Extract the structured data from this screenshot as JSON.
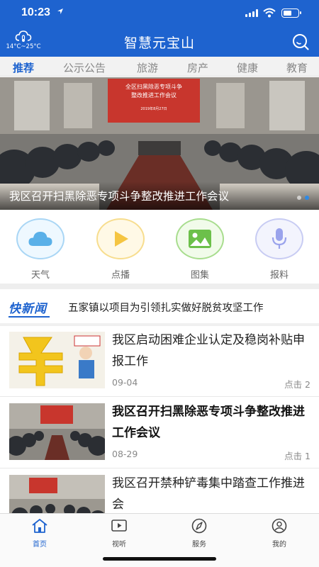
{
  "status": {
    "time": "10:23"
  },
  "header": {
    "weather_temp": "14°C~25°C",
    "title": "智慧元宝山"
  },
  "tabs": [
    "推荐",
    "公示公告",
    "旅游",
    "房产",
    "健康",
    "教育"
  ],
  "banner": {
    "caption": "我区召开扫黑除恶专项斗争整改推进工作会议",
    "sign_line1": "全区扫黑除恶专项斗争",
    "sign_line2": "整改推进工作会议",
    "sign_date": "2019年8月27日"
  },
  "functions": [
    {
      "label": "天气",
      "icon": "cloud-icon",
      "color": "#5ab0e8"
    },
    {
      "label": "点播",
      "icon": "play-icon",
      "color": "#f5c542"
    },
    {
      "label": "图集",
      "icon": "image-icon",
      "color": "#6cc04a"
    },
    {
      "label": "报料",
      "icon": "microphone-icon",
      "color": "#9aa3ec"
    }
  ],
  "flash_news": {
    "logo": "快新闻",
    "headline": "五家镇以项目为引领扎实做好脱贫攻坚工作"
  },
  "news": [
    {
      "title": "我区启动困难企业认定及稳岗补贴申报工作",
      "date": "09-04",
      "hits": "点击 2"
    },
    {
      "title": "我区召开扫黑除恶专项斗争整改推进工作会议",
      "date": "08-29",
      "hits": "点击 1"
    },
    {
      "title": "我区召开禁种铲毒集中踏查工作推进会",
      "date": "",
      "hits": ""
    }
  ],
  "bottom_nav": [
    {
      "label": "首页",
      "icon": "home-icon"
    },
    {
      "label": "视听",
      "icon": "video-icon"
    },
    {
      "label": "服务",
      "icon": "compass-icon"
    },
    {
      "label": "我的",
      "icon": "user-icon"
    }
  ],
  "colors": {
    "brand": "#1e63cf",
    "tabs_bg": "#f2f2f2"
  }
}
